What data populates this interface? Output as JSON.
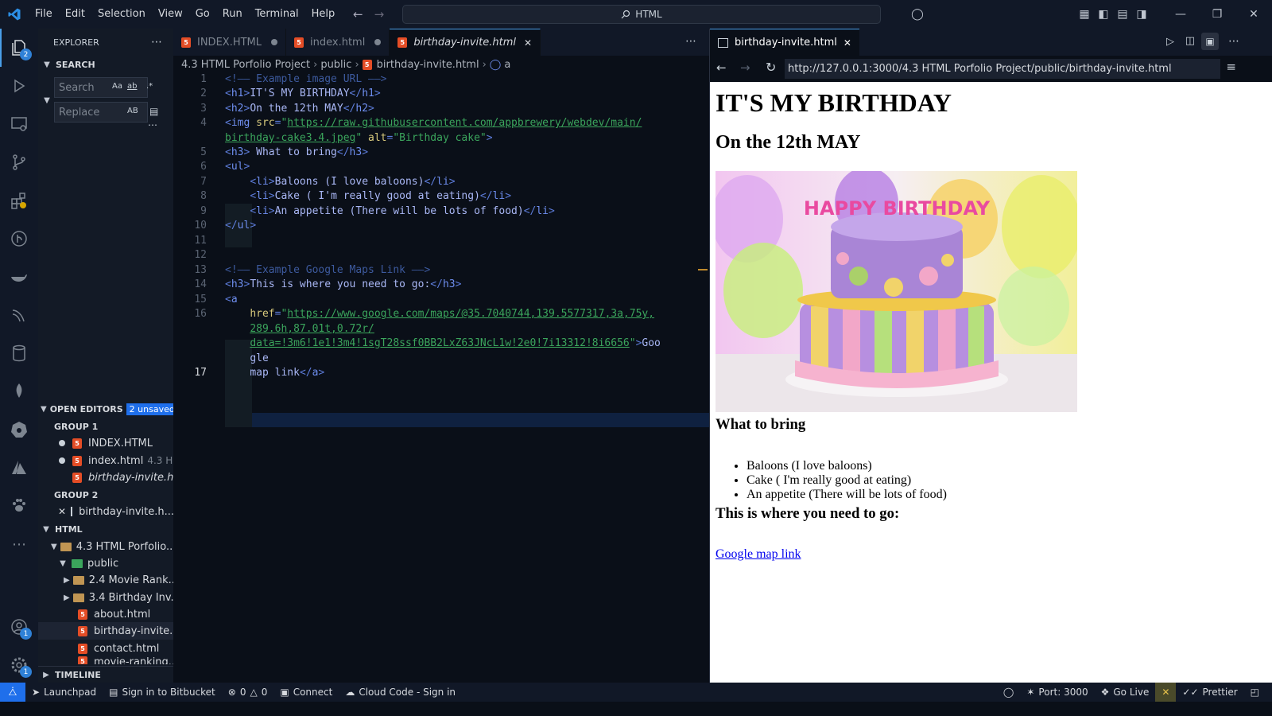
{
  "menu": [
    "File",
    "Edit",
    "Selection",
    "View",
    "Go",
    "Run",
    "Terminal",
    "Help"
  ],
  "command_center": "HTML",
  "sidebar": {
    "title": "EXPLORER",
    "search_section": "SEARCH",
    "search_placeholder": "Search",
    "replace_placeholder": "Replace",
    "search_opts": [
      "Aa",
      "ab",
      ".*"
    ],
    "replace_opt": "AB",
    "open_editors": "OPEN EDITORS",
    "unsaved": "2 unsaved",
    "group1": "GROUP 1",
    "group2": "GROUP 2",
    "g1_files": [
      "INDEX.HTML",
      "index.html",
      "birthday-invite.h..."
    ],
    "g1_hint": "4.3 H...",
    "g2_file": "birthday-invite.h...",
    "html_section": "HTML",
    "tree": [
      "4.3 HTML Porfolio...",
      "public",
      "2.4 Movie Rank...",
      "3.4 Birthday Inv...",
      "about.html",
      "birthday-invite....",
      "contact.html",
      "movie-ranking..."
    ],
    "timeline": "TIMELINE"
  },
  "tabs": [
    "INDEX.HTML",
    "index.html",
    "birthday-invite.html"
  ],
  "breadcrumb": [
    "4.3 HTML Porfolio Project",
    "public",
    "birthday-invite.html",
    "a"
  ],
  "preview": {
    "tab": "birthday-invite.html",
    "url": "http://127.0.0.1:3000/4.3 HTML Porfolio Project/public/birthday-invite.html",
    "h1": "IT'S MY BIRTHDAY",
    "h2": "On the 12th MAY",
    "cake_text": "HAPPY BIRTHDAY",
    "h3a": "What to bring",
    "items": [
      "Baloons (I love baloons)",
      "Cake ( I'm really good at eating)",
      "An appetite (There will be lots of food)"
    ],
    "h3b": "This is where you need to go:",
    "link": "Google map link"
  },
  "status": {
    "launchpad": "Launchpad",
    "bitbucket": "Sign in to Bitbucket",
    "errors": "0",
    "warnings": "0",
    "connect": "Connect",
    "cloud": "Cloud Code - Sign in",
    "port": "Port: 3000",
    "golive": "Go Live",
    "prettier": "Prettier"
  },
  "badges": {
    "explorer": "2",
    "accounts": "1",
    "settings": "1"
  },
  "colors": {
    "accent": "#1f6feb",
    "html_icon": "#e44d26",
    "bg": "#0a0f18"
  }
}
